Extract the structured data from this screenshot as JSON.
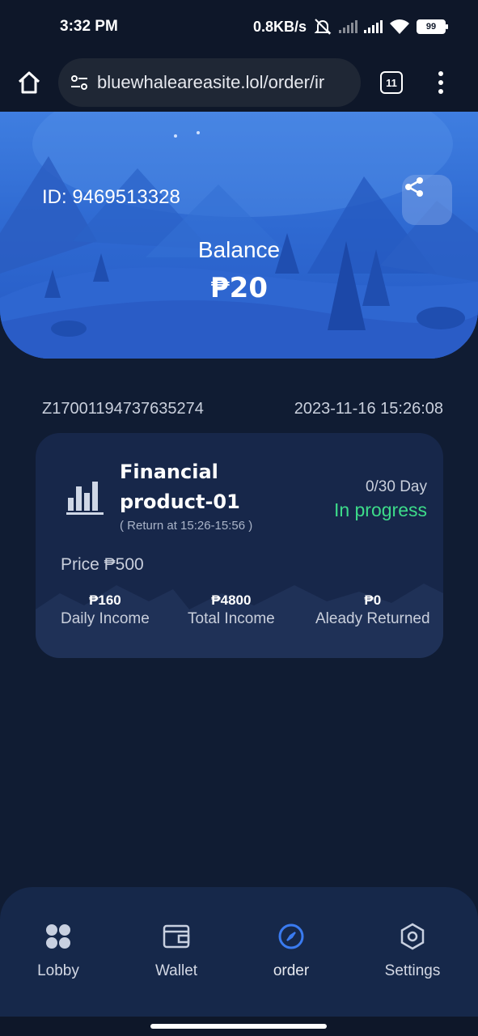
{
  "status_bar": {
    "time": "3:32 PM",
    "net_speed": "0.8KB/s",
    "battery": "99"
  },
  "browser": {
    "url": "bluewhaleareasite.lol/order/ir",
    "tab_count": "11"
  },
  "hero": {
    "user_id": "ID: 9469513328",
    "balance_label": "Balance",
    "balance_value": "₱20"
  },
  "order": {
    "number": "Z17001194737635274",
    "datetime": "2023-11-16 15:26:08",
    "product_title": "Financial product-01",
    "return_note": "( Return at 15:26-15:56 )",
    "days": "0/30 Day",
    "status": "In progress",
    "price": "Price ₱500",
    "stats": [
      {
        "value": "₱160",
        "label": "Daily Income"
      },
      {
        "value": "₱4800",
        "label": "Total Income"
      },
      {
        "value": "₱0",
        "label": "Aleady Returned"
      }
    ]
  },
  "nav": {
    "items": [
      {
        "label": "Lobby",
        "icon": "grid-icon"
      },
      {
        "label": "Wallet",
        "icon": "wallet-icon"
      },
      {
        "label": "order",
        "icon": "compass-icon"
      },
      {
        "label": "Settings",
        "icon": "hexagon-gear-icon"
      }
    ],
    "active_color": "#3a7bf0"
  },
  "colors": {
    "background": "#101c33",
    "card": "#17274a",
    "status_green": "#3ddc8a",
    "hero_blue": "#2f6ad2"
  }
}
